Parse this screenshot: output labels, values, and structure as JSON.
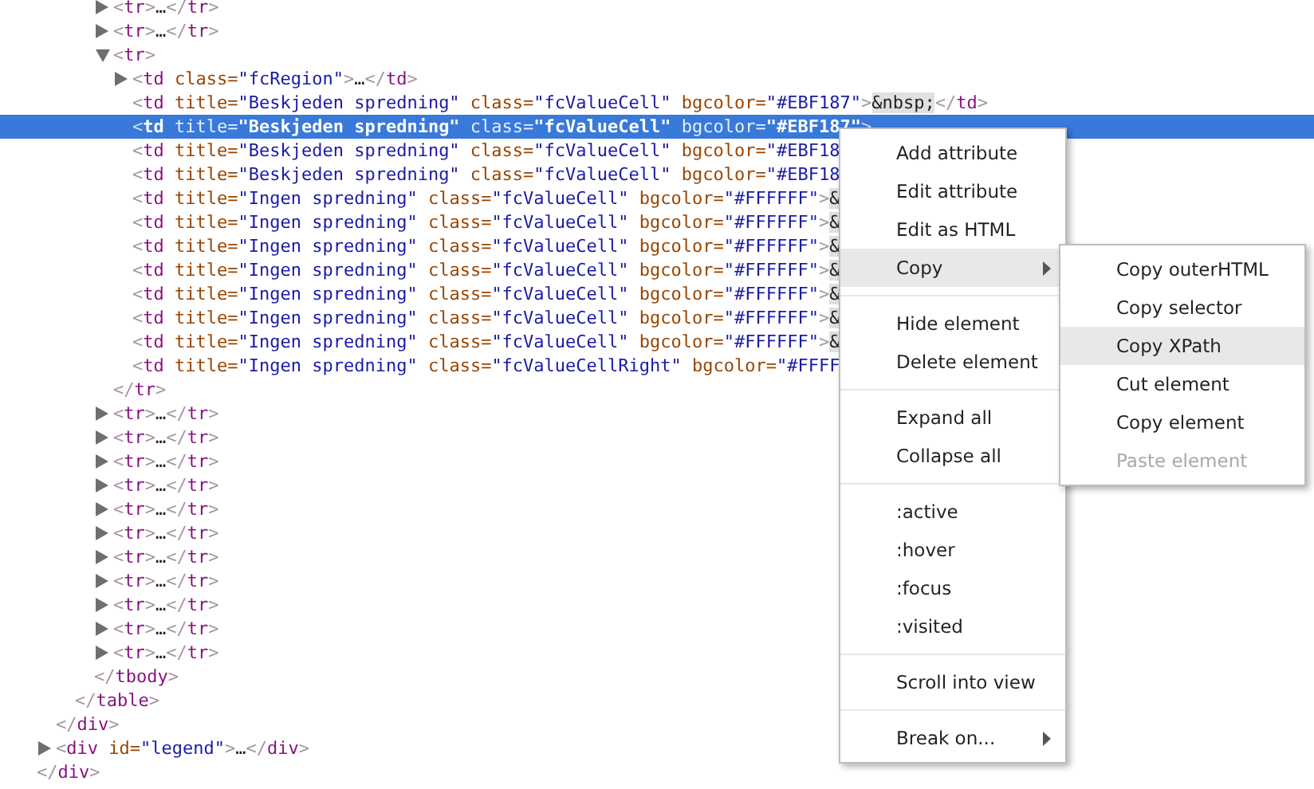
{
  "dom_tree": {
    "close": [
      {
        "kind": "punct",
        "text": "</"
      },
      {
        "kind": "tag",
        "text": "div"
      },
      {
        "kind": "punct",
        "text": ">"
      }
    ],
    "children": [
      {
        "close": [
          {
            "kind": "punct",
            "text": "</"
          },
          {
            "kind": "tag",
            "text": "div"
          },
          {
            "kind": "punct",
            "text": ">"
          }
        ],
        "children": [
          {
            "close": [
              {
                "kind": "punct",
                "text": "</"
              },
              {
                "kind": "tag",
                "text": "table"
              },
              {
                "kind": "punct",
                "text": ">"
              }
            ],
            "children": [
              {
                "close": [
                  {
                    "kind": "punct",
                    "text": "</"
                  },
                  {
                    "kind": "tag",
                    "text": "tbody"
                  },
                  {
                    "kind": "punct",
                    "text": ">"
                  }
                ],
                "children": [
                  {
                    "selected": false,
                    "expanded": false,
                    "line": [
                      {
                        "kind": "punct",
                        "text": "<"
                      },
                      {
                        "kind": "tag",
                        "text": "tr"
                      },
                      {
                        "kind": "punct",
                        "text": ">"
                      },
                      {
                        "kind": "text",
                        "text": "…"
                      },
                      {
                        "kind": "punct",
                        "text": "</"
                      },
                      {
                        "kind": "tag",
                        "text": "tr"
                      },
                      {
                        "kind": "punct",
                        "text": ">"
                      }
                    ]
                  },
                  {
                    "selected": false,
                    "expanded": false,
                    "line": [
                      {
                        "kind": "punct",
                        "text": "<"
                      },
                      {
                        "kind": "tag",
                        "text": "tr"
                      },
                      {
                        "kind": "punct",
                        "text": ">"
                      },
                      {
                        "kind": "text",
                        "text": "…"
                      },
                      {
                        "kind": "punct",
                        "text": "</"
                      },
                      {
                        "kind": "tag",
                        "text": "tr"
                      },
                      {
                        "kind": "punct",
                        "text": ">"
                      }
                    ]
                  },
                  {
                    "selected": false,
                    "expanded": true,
                    "line": [
                      {
                        "kind": "punct",
                        "text": "<"
                      },
                      {
                        "kind": "tag",
                        "text": "tr"
                      },
                      {
                        "kind": "punct",
                        "text": ">"
                      }
                    ],
                    "close": [
                      {
                        "kind": "punct",
                        "text": "</"
                      },
                      {
                        "kind": "tag",
                        "text": "tr"
                      },
                      {
                        "kind": "punct",
                        "text": ">"
                      }
                    ],
                    "children": [
                      {
                        "selected": false,
                        "expanded": false,
                        "line": [
                          {
                            "kind": "punct",
                            "text": "<"
                          },
                          {
                            "kind": "tag",
                            "text": "td"
                          },
                          {
                            "kind": "attr",
                            "text": " class="
                          },
                          {
                            "kind": "value",
                            "text": "\"fcRegion\""
                          },
                          {
                            "kind": "punct",
                            "text": ">"
                          },
                          {
                            "kind": "text",
                            "text": "…"
                          },
                          {
                            "kind": "punct",
                            "text": "</"
                          },
                          {
                            "kind": "tag",
                            "text": "td"
                          },
                          {
                            "kind": "punct",
                            "text": ">"
                          }
                        ]
                      },
                      {
                        "selected": false,
                        "line": [
                          {
                            "kind": "punct",
                            "text": "<"
                          },
                          {
                            "kind": "tag",
                            "text": "td"
                          },
                          {
                            "kind": "attr",
                            "text": " title="
                          },
                          {
                            "kind": "value",
                            "text": "\"Beskjeden spredning\""
                          },
                          {
                            "kind": "attr",
                            "text": " class="
                          },
                          {
                            "kind": "value",
                            "text": "\"fcValueCell\""
                          },
                          {
                            "kind": "attr",
                            "text": " bgcolor="
                          },
                          {
                            "kind": "value",
                            "text": "\"#EBF187\""
                          },
                          {
                            "kind": "punct",
                            "text": ">"
                          },
                          {
                            "kind": "entity",
                            "text": "&nbsp;"
                          },
                          {
                            "kind": "punct",
                            "text": "</"
                          },
                          {
                            "kind": "tag",
                            "text": "td"
                          },
                          {
                            "kind": "punct",
                            "text": ">"
                          }
                        ]
                      },
                      {
                        "selected": true,
                        "line": [
                          {
                            "kind": "punct",
                            "text": "<"
                          },
                          {
                            "kind": "tag",
                            "text": "td"
                          },
                          {
                            "kind": "attr",
                            "text": " title="
                          },
                          {
                            "kind": "value",
                            "text": "\"Beskjeden spredning\""
                          },
                          {
                            "kind": "attr",
                            "text": " class="
                          },
                          {
                            "kind": "value",
                            "text": "\"fcValueCell\""
                          },
                          {
                            "kind": "attr",
                            "text": " bgcolor="
                          },
                          {
                            "kind": "value",
                            "text": "\"#EBF187\""
                          },
                          {
                            "kind": "punct",
                            "text": ">"
                          }
                        ]
                      },
                      {
                        "selected": false,
                        "line": [
                          {
                            "kind": "punct",
                            "text": "<"
                          },
                          {
                            "kind": "tag",
                            "text": "td"
                          },
                          {
                            "kind": "attr",
                            "text": " title="
                          },
                          {
                            "kind": "value",
                            "text": "\"Beskjeden spredning\""
                          },
                          {
                            "kind": "attr",
                            "text": " class="
                          },
                          {
                            "kind": "value",
                            "text": "\"fcValueCell\""
                          },
                          {
                            "kind": "attr",
                            "text": " bgcolor="
                          },
                          {
                            "kind": "value",
                            "text": "\"#EBF18"
                          }
                        ]
                      },
                      {
                        "selected": false,
                        "line": [
                          {
                            "kind": "punct",
                            "text": "<"
                          },
                          {
                            "kind": "tag",
                            "text": "td"
                          },
                          {
                            "kind": "attr",
                            "text": " title="
                          },
                          {
                            "kind": "value",
                            "text": "\"Beskjeden spredning\""
                          },
                          {
                            "kind": "attr",
                            "text": " class="
                          },
                          {
                            "kind": "value",
                            "text": "\"fcValueCell\""
                          },
                          {
                            "kind": "attr",
                            "text": " bgcolor="
                          },
                          {
                            "kind": "value",
                            "text": "\"#EBF18"
                          }
                        ]
                      },
                      {
                        "selected": false,
                        "line": [
                          {
                            "kind": "punct",
                            "text": "<"
                          },
                          {
                            "kind": "tag",
                            "text": "td"
                          },
                          {
                            "kind": "attr",
                            "text": " title="
                          },
                          {
                            "kind": "value",
                            "text": "\"Ingen spredning\""
                          },
                          {
                            "kind": "attr",
                            "text": " class="
                          },
                          {
                            "kind": "value",
                            "text": "\"fcValueCell\""
                          },
                          {
                            "kind": "attr",
                            "text": " bgcolor="
                          },
                          {
                            "kind": "value",
                            "text": "\"#FFFFFF\""
                          },
                          {
                            "kind": "punct",
                            "text": ">"
                          },
                          {
                            "kind": "entity",
                            "text": "&"
                          }
                        ]
                      },
                      {
                        "selected": false,
                        "line": [
                          {
                            "kind": "punct",
                            "text": "<"
                          },
                          {
                            "kind": "tag",
                            "text": "td"
                          },
                          {
                            "kind": "attr",
                            "text": " title="
                          },
                          {
                            "kind": "value",
                            "text": "\"Ingen spredning\""
                          },
                          {
                            "kind": "attr",
                            "text": " class="
                          },
                          {
                            "kind": "value",
                            "text": "\"fcValueCell\""
                          },
                          {
                            "kind": "attr",
                            "text": " bgcolor="
                          },
                          {
                            "kind": "value",
                            "text": "\"#FFFFFF\""
                          },
                          {
                            "kind": "punct",
                            "text": ">"
                          },
                          {
                            "kind": "entity",
                            "text": "&"
                          }
                        ]
                      },
                      {
                        "selected": false,
                        "line": [
                          {
                            "kind": "punct",
                            "text": "<"
                          },
                          {
                            "kind": "tag",
                            "text": "td"
                          },
                          {
                            "kind": "attr",
                            "text": " title="
                          },
                          {
                            "kind": "value",
                            "text": "\"Ingen spredning\""
                          },
                          {
                            "kind": "attr",
                            "text": " class="
                          },
                          {
                            "kind": "value",
                            "text": "\"fcValueCell\""
                          },
                          {
                            "kind": "attr",
                            "text": " bgcolor="
                          },
                          {
                            "kind": "value",
                            "text": "\"#FFFFFF\""
                          },
                          {
                            "kind": "punct",
                            "text": ">"
                          },
                          {
                            "kind": "entity",
                            "text": "&"
                          }
                        ]
                      },
                      {
                        "selected": false,
                        "line": [
                          {
                            "kind": "punct",
                            "text": "<"
                          },
                          {
                            "kind": "tag",
                            "text": "td"
                          },
                          {
                            "kind": "attr",
                            "text": " title="
                          },
                          {
                            "kind": "value",
                            "text": "\"Ingen spredning\""
                          },
                          {
                            "kind": "attr",
                            "text": " class="
                          },
                          {
                            "kind": "value",
                            "text": "\"fcValueCell\""
                          },
                          {
                            "kind": "attr",
                            "text": " bgcolor="
                          },
                          {
                            "kind": "value",
                            "text": "\"#FFFFFF\""
                          },
                          {
                            "kind": "punct",
                            "text": ">"
                          },
                          {
                            "kind": "entity",
                            "text": "&"
                          }
                        ]
                      },
                      {
                        "selected": false,
                        "line": [
                          {
                            "kind": "punct",
                            "text": "<"
                          },
                          {
                            "kind": "tag",
                            "text": "td"
                          },
                          {
                            "kind": "attr",
                            "text": " title="
                          },
                          {
                            "kind": "value",
                            "text": "\"Ingen spredning\""
                          },
                          {
                            "kind": "attr",
                            "text": " class="
                          },
                          {
                            "kind": "value",
                            "text": "\"fcValueCell\""
                          },
                          {
                            "kind": "attr",
                            "text": " bgcolor="
                          },
                          {
                            "kind": "value",
                            "text": "\"#FFFFFF\""
                          },
                          {
                            "kind": "punct",
                            "text": ">"
                          },
                          {
                            "kind": "entity",
                            "text": "&"
                          }
                        ]
                      },
                      {
                        "selected": false,
                        "line": [
                          {
                            "kind": "punct",
                            "text": "<"
                          },
                          {
                            "kind": "tag",
                            "text": "td"
                          },
                          {
                            "kind": "attr",
                            "text": " title="
                          },
                          {
                            "kind": "value",
                            "text": "\"Ingen spredning\""
                          },
                          {
                            "kind": "attr",
                            "text": " class="
                          },
                          {
                            "kind": "value",
                            "text": "\"fcValueCell\""
                          },
                          {
                            "kind": "attr",
                            "text": " bgcolor="
                          },
                          {
                            "kind": "value",
                            "text": "\"#FFFFFF\""
                          },
                          {
                            "kind": "punct",
                            "text": ">"
                          },
                          {
                            "kind": "entity",
                            "text": "&"
                          }
                        ]
                      },
                      {
                        "selected": false,
                        "line": [
                          {
                            "kind": "punct",
                            "text": "<"
                          },
                          {
                            "kind": "tag",
                            "text": "td"
                          },
                          {
                            "kind": "attr",
                            "text": " title="
                          },
                          {
                            "kind": "value",
                            "text": "\"Ingen spredning\""
                          },
                          {
                            "kind": "attr",
                            "text": " class="
                          },
                          {
                            "kind": "value",
                            "text": "\"fcValueCell\""
                          },
                          {
                            "kind": "attr",
                            "text": " bgcolor="
                          },
                          {
                            "kind": "value",
                            "text": "\"#FFFFFF\""
                          },
                          {
                            "kind": "punct",
                            "text": ">"
                          },
                          {
                            "kind": "entity",
                            "text": "&"
                          }
                        ]
                      },
                      {
                        "selected": false,
                        "line": [
                          {
                            "kind": "punct",
                            "text": "<"
                          },
                          {
                            "kind": "tag",
                            "text": "td"
                          },
                          {
                            "kind": "attr",
                            "text": " title="
                          },
                          {
                            "kind": "value",
                            "text": "\"Ingen spredning\""
                          },
                          {
                            "kind": "attr",
                            "text": " class="
                          },
                          {
                            "kind": "value",
                            "text": "\"fcValueCellRight\""
                          },
                          {
                            "kind": "attr",
                            "text": " bgcolor="
                          },
                          {
                            "kind": "value",
                            "text": "\"#FFFF"
                          }
                        ]
                      }
                    ]
                  },
                  {
                    "selected": false,
                    "expanded": false,
                    "line": [
                      {
                        "kind": "punct",
                        "text": "<"
                      },
                      {
                        "kind": "tag",
                        "text": "tr"
                      },
                      {
                        "kind": "punct",
                        "text": ">"
                      },
                      {
                        "kind": "text",
                        "text": "…"
                      },
                      {
                        "kind": "punct",
                        "text": "</"
                      },
                      {
                        "kind": "tag",
                        "text": "tr"
                      },
                      {
                        "kind": "punct",
                        "text": ">"
                      }
                    ]
                  },
                  {
                    "selected": false,
                    "expanded": false,
                    "line": [
                      {
                        "kind": "punct",
                        "text": "<"
                      },
                      {
                        "kind": "tag",
                        "text": "tr"
                      },
                      {
                        "kind": "punct",
                        "text": ">"
                      },
                      {
                        "kind": "text",
                        "text": "…"
                      },
                      {
                        "kind": "punct",
                        "text": "</"
                      },
                      {
                        "kind": "tag",
                        "text": "tr"
                      },
                      {
                        "kind": "punct",
                        "text": ">"
                      }
                    ]
                  },
                  {
                    "selected": false,
                    "expanded": false,
                    "line": [
                      {
                        "kind": "punct",
                        "text": "<"
                      },
                      {
                        "kind": "tag",
                        "text": "tr"
                      },
                      {
                        "kind": "punct",
                        "text": ">"
                      },
                      {
                        "kind": "text",
                        "text": "…"
                      },
                      {
                        "kind": "punct",
                        "text": "</"
                      },
                      {
                        "kind": "tag",
                        "text": "tr"
                      },
                      {
                        "kind": "punct",
                        "text": ">"
                      }
                    ]
                  },
                  {
                    "selected": false,
                    "expanded": false,
                    "line": [
                      {
                        "kind": "punct",
                        "text": "<"
                      },
                      {
                        "kind": "tag",
                        "text": "tr"
                      },
                      {
                        "kind": "punct",
                        "text": ">"
                      },
                      {
                        "kind": "text",
                        "text": "…"
                      },
                      {
                        "kind": "punct",
                        "text": "</"
                      },
                      {
                        "kind": "tag",
                        "text": "tr"
                      },
                      {
                        "kind": "punct",
                        "text": ">"
                      }
                    ]
                  },
                  {
                    "selected": false,
                    "expanded": false,
                    "line": [
                      {
                        "kind": "punct",
                        "text": "<"
                      },
                      {
                        "kind": "tag",
                        "text": "tr"
                      },
                      {
                        "kind": "punct",
                        "text": ">"
                      },
                      {
                        "kind": "text",
                        "text": "…"
                      },
                      {
                        "kind": "punct",
                        "text": "</"
                      },
                      {
                        "kind": "tag",
                        "text": "tr"
                      },
                      {
                        "kind": "punct",
                        "text": ">"
                      }
                    ]
                  },
                  {
                    "selected": false,
                    "expanded": false,
                    "line": [
                      {
                        "kind": "punct",
                        "text": "<"
                      },
                      {
                        "kind": "tag",
                        "text": "tr"
                      },
                      {
                        "kind": "punct",
                        "text": ">"
                      },
                      {
                        "kind": "text",
                        "text": "…"
                      },
                      {
                        "kind": "punct",
                        "text": "</"
                      },
                      {
                        "kind": "tag",
                        "text": "tr"
                      },
                      {
                        "kind": "punct",
                        "text": ">"
                      }
                    ]
                  },
                  {
                    "selected": false,
                    "expanded": false,
                    "line": [
                      {
                        "kind": "punct",
                        "text": "<"
                      },
                      {
                        "kind": "tag",
                        "text": "tr"
                      },
                      {
                        "kind": "punct",
                        "text": ">"
                      },
                      {
                        "kind": "text",
                        "text": "…"
                      },
                      {
                        "kind": "punct",
                        "text": "</"
                      },
                      {
                        "kind": "tag",
                        "text": "tr"
                      },
                      {
                        "kind": "punct",
                        "text": ">"
                      }
                    ]
                  },
                  {
                    "selected": false,
                    "expanded": false,
                    "line": [
                      {
                        "kind": "punct",
                        "text": "<"
                      },
                      {
                        "kind": "tag",
                        "text": "tr"
                      },
                      {
                        "kind": "punct",
                        "text": ">"
                      },
                      {
                        "kind": "text",
                        "text": "…"
                      },
                      {
                        "kind": "punct",
                        "text": "</"
                      },
                      {
                        "kind": "tag",
                        "text": "tr"
                      },
                      {
                        "kind": "punct",
                        "text": ">"
                      }
                    ]
                  },
                  {
                    "selected": false,
                    "expanded": false,
                    "line": [
                      {
                        "kind": "punct",
                        "text": "<"
                      },
                      {
                        "kind": "tag",
                        "text": "tr"
                      },
                      {
                        "kind": "punct",
                        "text": ">"
                      },
                      {
                        "kind": "text",
                        "text": "…"
                      },
                      {
                        "kind": "punct",
                        "text": "</"
                      },
                      {
                        "kind": "tag",
                        "text": "tr"
                      },
                      {
                        "kind": "punct",
                        "text": ">"
                      }
                    ]
                  },
                  {
                    "selected": false,
                    "expanded": false,
                    "line": [
                      {
                        "kind": "punct",
                        "text": "<"
                      },
                      {
                        "kind": "tag",
                        "text": "tr"
                      },
                      {
                        "kind": "punct",
                        "text": ">"
                      },
                      {
                        "kind": "text",
                        "text": "…"
                      },
                      {
                        "kind": "punct",
                        "text": "</"
                      },
                      {
                        "kind": "tag",
                        "text": "tr"
                      },
                      {
                        "kind": "punct",
                        "text": ">"
                      }
                    ]
                  },
                  {
                    "selected": false,
                    "expanded": false,
                    "line": [
                      {
                        "kind": "punct",
                        "text": "<"
                      },
                      {
                        "kind": "tag",
                        "text": "tr"
                      },
                      {
                        "kind": "punct",
                        "text": ">"
                      },
                      {
                        "kind": "text",
                        "text": "…"
                      },
                      {
                        "kind": "punct",
                        "text": "</"
                      },
                      {
                        "kind": "tag",
                        "text": "tr"
                      },
                      {
                        "kind": "punct",
                        "text": ">"
                      }
                    ]
                  }
                ]
              }
            ]
          }
        ]
      },
      {
        "selected": false,
        "expanded": false,
        "line": [
          {
            "kind": "punct",
            "text": "<"
          },
          {
            "kind": "tag",
            "text": "div"
          },
          {
            "kind": "attr",
            "text": " id="
          },
          {
            "kind": "value",
            "text": "\"legend\""
          },
          {
            "kind": "punct",
            "text": ">"
          },
          {
            "kind": "text",
            "text": "…"
          },
          {
            "kind": "punct",
            "text": "</"
          },
          {
            "kind": "tag",
            "text": "div"
          },
          {
            "kind": "punct",
            "text": ">"
          }
        ]
      }
    ]
  },
  "context_menu": {
    "groups": [
      [
        {
          "label": "Add attribute",
          "highlighted": false,
          "has_submenu": false
        },
        {
          "label": "Edit attribute",
          "highlighted": false,
          "has_submenu": false
        },
        {
          "label": "Edit as HTML",
          "highlighted": false,
          "has_submenu": false
        },
        {
          "label": "Copy",
          "highlighted": true,
          "has_submenu": true
        }
      ],
      [
        {
          "label": "Hide element",
          "highlighted": false,
          "has_submenu": false
        },
        {
          "label": "Delete element",
          "highlighted": false,
          "has_submenu": false
        }
      ],
      [
        {
          "label": "Expand all",
          "highlighted": false,
          "has_submenu": false
        },
        {
          "label": "Collapse all",
          "highlighted": false,
          "has_submenu": false
        }
      ],
      [
        {
          "label": ":active",
          "highlighted": false,
          "has_submenu": false
        },
        {
          "label": ":hover",
          "highlighted": false,
          "has_submenu": false
        },
        {
          "label": ":focus",
          "highlighted": false,
          "has_submenu": false
        },
        {
          "label": ":visited",
          "highlighted": false,
          "has_submenu": false
        }
      ],
      [
        {
          "label": "Scroll into view",
          "highlighted": false,
          "has_submenu": false
        }
      ],
      [
        {
          "label": "Break on...",
          "highlighted": false,
          "has_submenu": true
        }
      ]
    ]
  },
  "copy_submenu": {
    "items": [
      {
        "label": "Copy outerHTML",
        "highlighted": false,
        "disabled": false
      },
      {
        "label": "Copy selector",
        "highlighted": false,
        "disabled": false
      },
      {
        "label": "Copy XPath",
        "highlighted": true,
        "disabled": false
      },
      {
        "label": "Cut element",
        "highlighted": false,
        "disabled": false
      },
      {
        "label": "Copy element",
        "highlighted": false,
        "disabled": false
      },
      {
        "label": "Paste element",
        "highlighted": false,
        "disabled": true
      }
    ]
  }
}
